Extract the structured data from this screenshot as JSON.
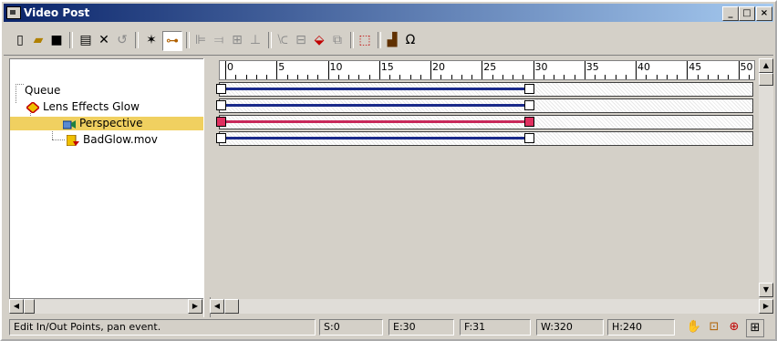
{
  "window": {
    "title": "Video Post",
    "minimize": "_",
    "maximize": "□",
    "close": "×"
  },
  "toolbar": {
    "icons": [
      "new-sequence-icon",
      "open-sequence-icon",
      "save-sequence-icon",
      "edit-event-icon",
      "delete-event-icon",
      "swap-events-icon",
      "execute-sequence-icon",
      "edit-range-bar-icon",
      "align-left-icon",
      "align-right-icon",
      "make-same-size-icon",
      "abut-events-icon",
      "add-scene-event-icon",
      "add-image-input-icon",
      "add-image-filter-icon",
      "add-image-layer-icon",
      "add-image-output-icon",
      "add-external-icon",
      "add-loop-icon"
    ]
  },
  "tree": {
    "items": [
      {
        "label": "Queue"
      },
      {
        "label": "Lens Effects Glow"
      },
      {
        "label": "Perspective"
      },
      {
        "label": "BadGlow.mov"
      }
    ]
  },
  "ruler": {
    "labels": [
      "0",
      "5",
      "10",
      "15",
      "20",
      "25",
      "30",
      "35",
      "40",
      "45",
      "50"
    ]
  },
  "tracks": [
    {
      "start": 0,
      "end": 30,
      "color": "#1a2a8a"
    },
    {
      "start": 0,
      "end": 30,
      "color": "#1a2a8a"
    },
    {
      "start": 0,
      "end": 30,
      "color": "#c8285a"
    },
    {
      "start": 0,
      "end": 30,
      "color": "#1a2a8a"
    }
  ],
  "status": {
    "message": "Edit In/Out Points, pan event.",
    "start": "S:0",
    "end": "E:30",
    "frames": "F:31",
    "width": "W:320",
    "height": "H:240"
  },
  "colors": {
    "selection": "#f0d060",
    "title_bar": "#0a246a"
  }
}
